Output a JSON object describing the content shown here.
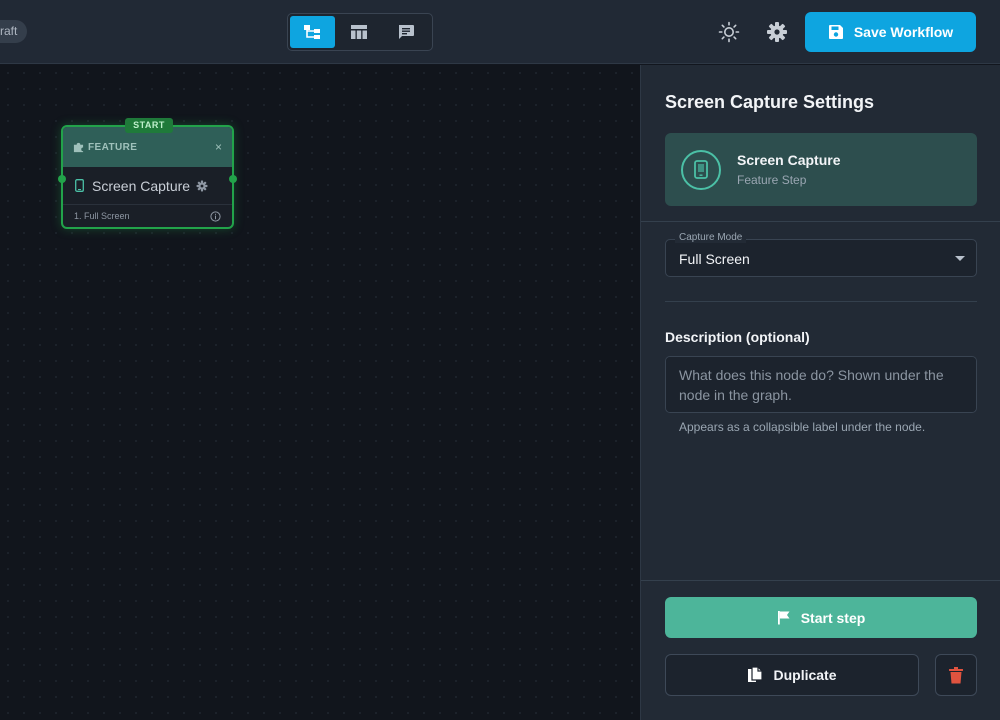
{
  "header": {
    "draft_label": "raft",
    "view_toggle": {
      "active": "graph-view",
      "items": [
        "graph-view",
        "table-view",
        "comments-view"
      ]
    },
    "save_label": "Save Workflow"
  },
  "canvas": {
    "node": {
      "badge": "START",
      "header_label": "FEATURE",
      "close_glyph": "×",
      "title": "Screen Capture",
      "footer": "1. Full Screen"
    }
  },
  "panel": {
    "title": "Screen Capture Settings",
    "feature_card": {
      "name": "Screen Capture",
      "subtitle": "Feature Step"
    },
    "capture_mode": {
      "label": "Capture Mode",
      "value": "Full Screen"
    },
    "description": {
      "label": "Description (optional)",
      "placeholder": "What does this node do? Shown under the node in the graph.",
      "value": "",
      "help": "Appears as a collapsible label under the node."
    },
    "start_label": "Start step",
    "duplicate_label": "Duplicate"
  },
  "colors": {
    "accent": "#0ea5e0",
    "start_button": "#4db59a",
    "node_border": "#22a34a",
    "delete_icon": "#e0533f"
  }
}
